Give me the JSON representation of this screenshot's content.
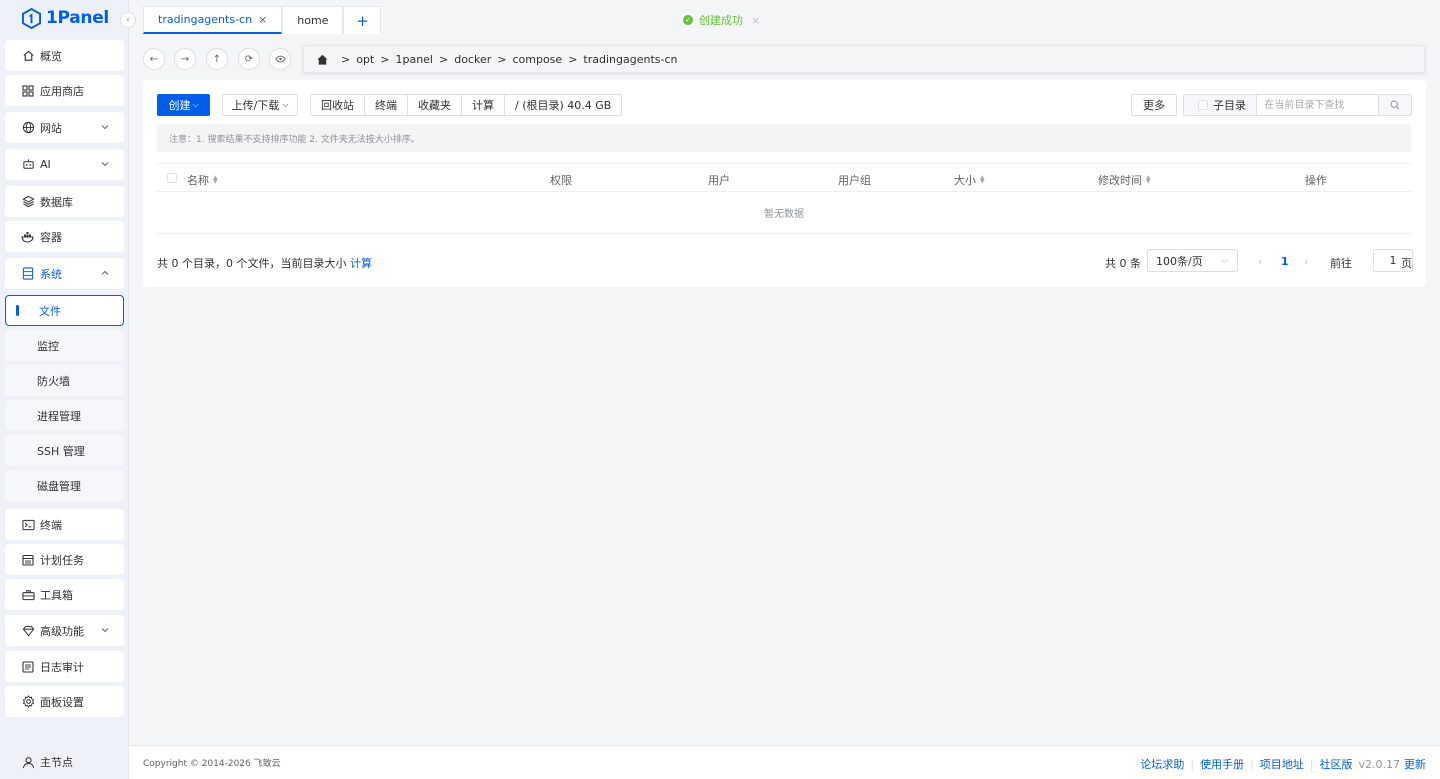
{
  "brand": {
    "name": "1Panel",
    "color": "#005eeb"
  },
  "sidebar": {
    "items": [
      {
        "label": "概览",
        "icon": "home-icon"
      },
      {
        "label": "应用商店",
        "icon": "grid-icon"
      },
      {
        "label": "网站",
        "icon": "globe-icon",
        "expandable": true
      },
      {
        "label": "AI",
        "icon": "robot-icon",
        "expandable": true
      },
      {
        "label": "数据库",
        "icon": "layers-icon"
      },
      {
        "label": "容器",
        "icon": "docker-icon"
      },
      {
        "label": "系统",
        "icon": "server-icon",
        "expanded": true
      },
      {
        "label": "文件",
        "active": true
      },
      {
        "label": "监控"
      },
      {
        "label": "防火墙"
      },
      {
        "label": "进程管理"
      },
      {
        "label": "SSH 管理"
      },
      {
        "label": "磁盘管理"
      },
      {
        "label": "终端",
        "icon": "terminal-icon"
      },
      {
        "label": "计划任务",
        "icon": "calendar-icon"
      },
      {
        "label": "工具箱",
        "icon": "toolbox-icon"
      },
      {
        "label": "高级功能",
        "icon": "diamond-icon",
        "expandable": true
      },
      {
        "label": "日志审计",
        "icon": "log-icon"
      },
      {
        "label": "面板设置",
        "icon": "gear-icon"
      }
    ],
    "node_label": "主节点"
  },
  "tabs": [
    {
      "label": "tradingagents-cn",
      "active": true
    },
    {
      "label": "home"
    }
  ],
  "toast": {
    "text": "创建成功"
  },
  "breadcrumb": [
    "opt",
    "1panel",
    "docker",
    "compose",
    "tradingagents-cn"
  ],
  "toolbar": {
    "create": "创建",
    "upload": "上传/下载",
    "group": [
      "回收站",
      "终端",
      "收藏夹",
      "计算",
      "/ (根目录) 40.4 GB"
    ],
    "more": "更多",
    "subdir": "子目录",
    "search_placeholder": "在当前目录下查找"
  },
  "note": "注意：1. 搜索结果不支持排序功能 2. 文件夹无法按大小排序。",
  "table": {
    "columns": [
      "名称",
      "权限",
      "用户",
      "用户组",
      "大小",
      "修改时间",
      "操作"
    ],
    "empty": "暂无数据"
  },
  "summary": {
    "text": "共 0 个目录，0 个文件，当前目录大小",
    "link": "计算"
  },
  "pagination": {
    "total": "共 0 条",
    "page_size": "100条/页",
    "current": "1",
    "goto": "前往",
    "goto_value": "1",
    "page_suffix": "页"
  },
  "footer": {
    "copyright": "Copyright © 2014-2026 飞致云",
    "links": [
      "论坛求助",
      "使用手册",
      "项目地址",
      "社区版"
    ],
    "version": "v2.0.17",
    "update": "更新"
  }
}
